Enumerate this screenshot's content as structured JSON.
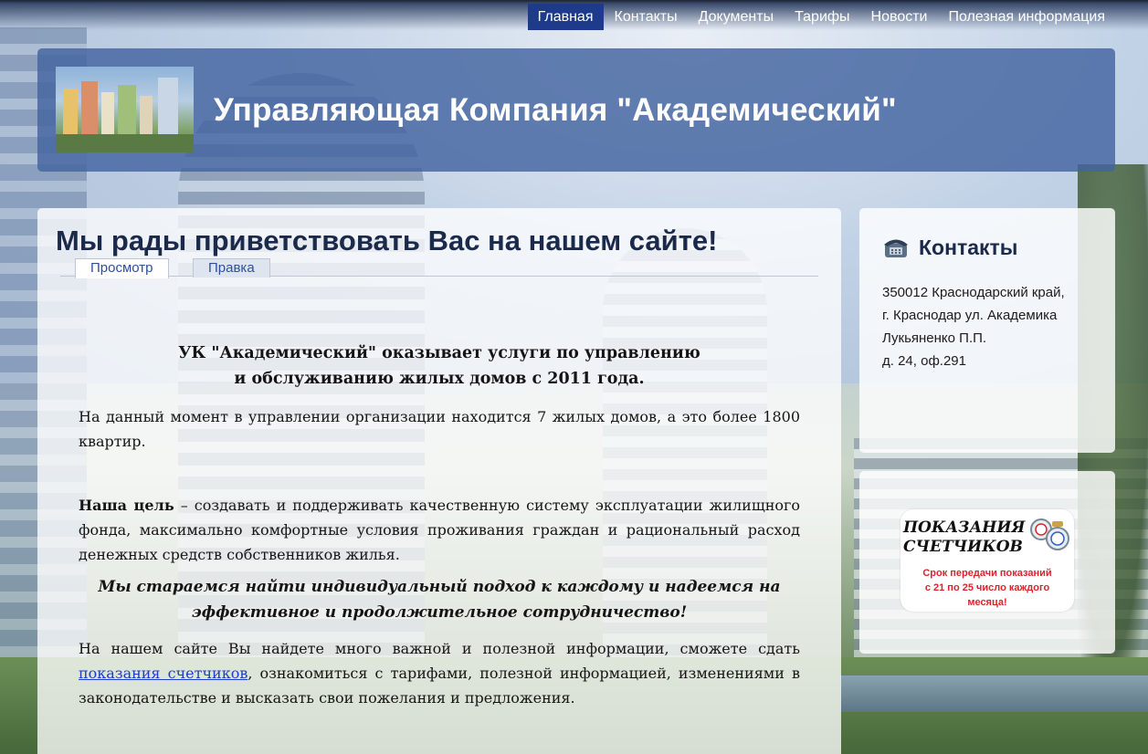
{
  "nav": {
    "items": [
      {
        "label": "Главная",
        "active": true
      },
      {
        "label": "Контакты",
        "active": false
      },
      {
        "label": "Документы",
        "active": false
      },
      {
        "label": "Тарифы",
        "active": false
      },
      {
        "label": "Новости",
        "active": false
      },
      {
        "label": "Полезная информация",
        "active": false
      }
    ]
  },
  "header": {
    "logo_icon": "building-photo-logo",
    "title": "Управляющая Компания \"Академический\""
  },
  "main": {
    "page_title": "Мы рады приветствовать Вас на нашем сайте!",
    "tabs": [
      {
        "label": "Просмотр",
        "active": true
      },
      {
        "label": "Правка",
        "active": false
      }
    ],
    "lead_line1": "УК \"Академический\" оказывает услуги по управлению",
    "lead_line2": "и обслуживанию жилых домов с 2011 года.",
    "para1": "На данный момент в управлении организации находится 7 жилых домов, а это более 1800 квартир.",
    "goal_label": "Наша цель",
    "goal_text": " – создавать и поддерживать качественную систему эксплуатации жилищного фонда, максимально комфортные условия проживания граждан и рациональный расход денежных средств собственников жилья.",
    "quote_line1": "Мы стараемся найти индивидуальный подход к каждому и надеемся на",
    "quote_line2": "эффективное и продолжительное сотрудничество!",
    "bottom_text_start": "На нашем сайте Вы найдете много важной и полезной информации, сможете сдать ",
    "bottom_link": "показания счетчиков",
    "bottom_text_end": ", ознакомиться с тарифами, полезной информацией, изменениями в законодательстве и высказать свои пожелания и предложения."
  },
  "sidebar": {
    "contacts": {
      "icon": "phone-icon",
      "title": "Контакты",
      "address_lines": [
        "350012 Краснодарский край,",
        "г. Краснодар ул. Академика",
        "Лукьяненко П.П.",
        "д. 24, оф.291"
      ]
    },
    "meters": {
      "icon": "meter-dials-icon",
      "title_line1": "ПОКАЗАНИЯ",
      "title_line2": "СЧЕТЧИКОВ",
      "note_line1": "Срок передачи показаний",
      "note_line2": "с 21 по 25 число каждого",
      "note_line3": "месяца!"
    }
  },
  "colors": {
    "nav_active": "#1e3a8a",
    "header_bg": "#4364a0",
    "title_text": "#1b2a4a",
    "link": "#1a3fc4",
    "alert": "#d6262d"
  }
}
